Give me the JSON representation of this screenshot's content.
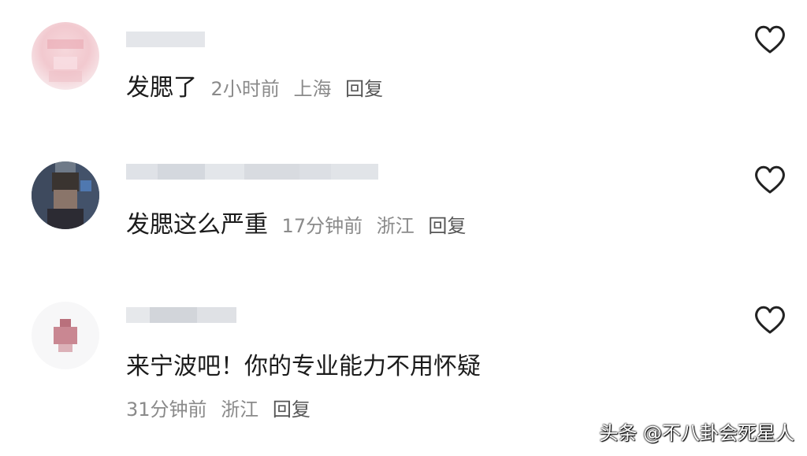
{
  "comments": [
    {
      "text": "发腮了",
      "time": "2小时前",
      "location": "上海",
      "reply_label": "回复",
      "avatar_icon": "blurred-avatar",
      "like_icon": "heart-outline-icon"
    },
    {
      "text": "发腮这么严重",
      "time": "17分钟前",
      "location": "浙江",
      "reply_label": "回复",
      "avatar_icon": "blurred-avatar",
      "like_icon": "heart-outline-icon"
    },
    {
      "text": "来宁波吧！你的专业能力不用怀疑",
      "time": "31分钟前",
      "location": "浙江",
      "reply_label": "回复",
      "avatar_icon": "blurred-avatar",
      "like_icon": "heart-outline-icon"
    }
  ],
  "watermark": "头条 @不八卦会死星人",
  "colors": {
    "text": "#1b1b1b",
    "meta": "#8a8a8a",
    "icon": "#222222"
  }
}
